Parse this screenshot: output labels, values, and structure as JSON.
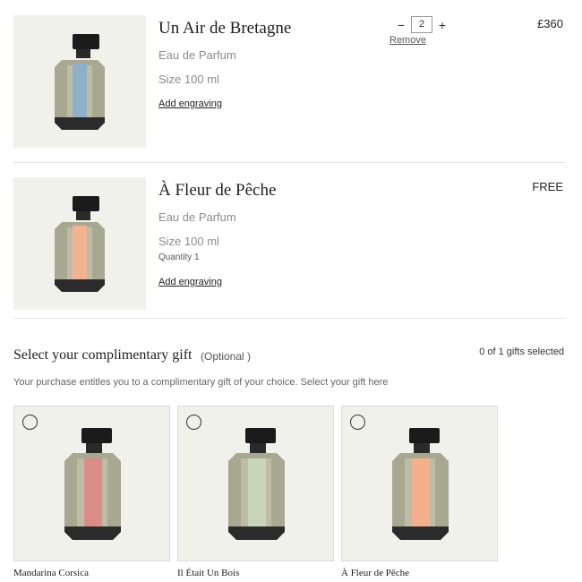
{
  "cart": {
    "items": [
      {
        "name": "Un Air de Bretagne",
        "type": "Eau de Parfum",
        "size": "Size  100 ml",
        "engraving": "Add engraving",
        "price": "£360",
        "quantity": "2",
        "minus": "−",
        "plus": "+",
        "remove": "Remove",
        "label_color": "#8fb0c8"
      },
      {
        "name": "À Fleur de Pêche",
        "type": "Eau de Parfum",
        "size": "Size  100 ml",
        "quantity_text": "Quantity  1",
        "engraving": "Add engraving",
        "price": "FREE",
        "label_color": "#f1b391"
      }
    ]
  },
  "gift": {
    "title": "Select your complimentary gift",
    "optional": "(Optional )",
    "count": "0 of 1 gifts selected",
    "description": "Your purchase entitles you to a complimentary gift of your choice. Select your gift here",
    "options": [
      {
        "name": "Mandarina Corsica",
        "label_color": "#d98d86"
      },
      {
        "name": "Il Était Un Bois",
        "label_color": "#c7d6b8"
      },
      {
        "name": "À Fleur de Pêche",
        "label_color": "#f2b08c"
      }
    ]
  },
  "colors": {
    "thumb_bg": "#f1f1ec",
    "text": "#1e1e1e",
    "muted": "#8c8c8c"
  }
}
